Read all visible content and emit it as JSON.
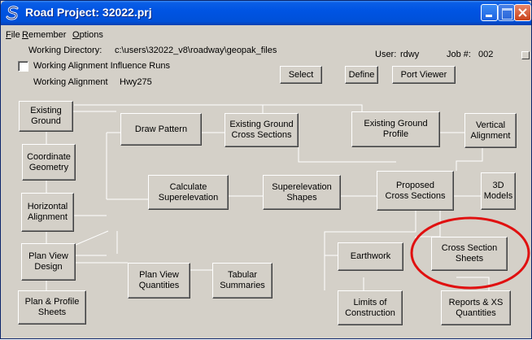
{
  "window": {
    "title": "Road Project: 32022.prj",
    "icon": "geopak-s-icon"
  },
  "menu": {
    "items": [
      "File",
      "Remember",
      "Options"
    ]
  },
  "info": {
    "working_directory_label": "Working Directory:",
    "working_directory_value": "c:\\users\\32022_v8\\roadway\\geopak_files",
    "user_label": "User:",
    "user_value": "rdwy",
    "job_label": "Job #:",
    "job_value": "002",
    "influence_runs_label": "Working Alignment Influence Runs",
    "influence_runs_checked": false,
    "working_alignment_label": "Working Alignment",
    "working_alignment_value": "Hwy275"
  },
  "top_buttons": {
    "select": "Select",
    "define": "Define",
    "port_viewer": "Port Viewer"
  },
  "flow_buttons": {
    "existing_ground": [
      "Existing",
      "Ground"
    ],
    "draw_pattern": [
      "Draw Pattern"
    ],
    "existing_ground_cross_sections": [
      "Existing Ground",
      "Cross Sections"
    ],
    "existing_ground_profile": [
      "Existing Ground",
      "Profile"
    ],
    "vertical_alignment": [
      "Vertical",
      "Alignment"
    ],
    "coordinate_geometry": [
      "Coordinate",
      "Geometry"
    ],
    "calculate_superelevation": [
      "Calculate",
      "Superelevation"
    ],
    "superelevation_shapes": [
      "Superelevation",
      "Shapes"
    ],
    "proposed_cross_sections": [
      "Proposed",
      "Cross Sections"
    ],
    "models_3d": [
      "3D",
      "Models"
    ],
    "horizontal_alignment": [
      "Horizontal",
      "Alignment"
    ],
    "plan_view_design": [
      "Plan View",
      "Design"
    ],
    "earthwork": [
      "Earthwork"
    ],
    "cross_section_sheets": [
      "Cross Section",
      "Sheets"
    ],
    "plan_view_quantities": [
      "Plan View",
      "Quantities"
    ],
    "tabular_summaries": [
      "Tabular",
      "Summaries"
    ],
    "plan_profile_sheets": [
      "Plan & Profile",
      "Sheets"
    ],
    "limits_of_construction": [
      "Limits of",
      "Construction"
    ],
    "reports_xs_quantities": [
      "Reports & XS",
      "Quantities"
    ]
  },
  "colors": {
    "title_bar": "#0054e3",
    "dialog_face": "#d4d0c8",
    "connector_line": "#ffffff",
    "highlight_circle": "#e01010"
  }
}
